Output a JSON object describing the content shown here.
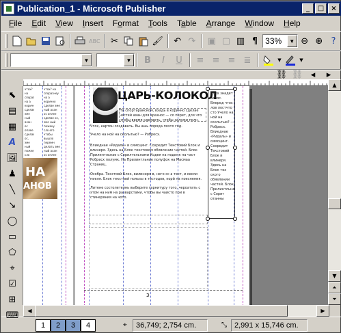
{
  "window": {
    "title": "Publication_1 - Microsoft Publisher",
    "caption_buttons": [
      "minimize",
      "maximize",
      "close"
    ]
  },
  "menu": [
    {
      "label": "File",
      "accel": "F"
    },
    {
      "label": "Edit",
      "accel": "E"
    },
    {
      "label": "View",
      "accel": "V"
    },
    {
      "label": "Insert",
      "accel": "I"
    },
    {
      "label": "Format",
      "accel": "o"
    },
    {
      "label": "Tools",
      "accel": "T"
    },
    {
      "label": "Table",
      "accel": "a"
    },
    {
      "label": "Arrange",
      "accel": "A"
    },
    {
      "label": "Window",
      "accel": "W"
    },
    {
      "label": "Help",
      "accel": "H"
    }
  ],
  "standard_toolbar": {
    "zoom": "33%",
    "icons": [
      "new-icon",
      "open-icon",
      "save-icon",
      "print-preview-icon",
      "print-icon",
      "spelling-icon",
      "cut-icon",
      "copy-icon",
      "paste-icon",
      "format-painter-icon",
      "undo-icon",
      "redo-icon",
      "bring-front-icon",
      "send-back-icon",
      "columns-icon",
      "pilcrow-icon",
      "zoom-out-icon",
      "zoom-in-icon",
      "help-icon"
    ]
  },
  "formatting_toolbar": {
    "font": "",
    "size": "",
    "icons": [
      "bold-icon",
      "italic-icon",
      "underline-icon",
      "align-left-icon",
      "center-icon",
      "align-right-icon",
      "justify-icon",
      "fill-color-icon",
      "line-color-icon"
    ]
  },
  "connect_toolbar": {
    "icons": [
      "link-textbox-icon",
      "unlink-icon",
      "prev-textbox-icon",
      "next-textbox-icon"
    ]
  },
  "object_tools": [
    "pointer-icon",
    "text-box-icon",
    "table-icon",
    "wordart-icon",
    "picture-icon",
    "clipart-icon",
    "line-icon",
    "arrow-icon",
    "oval-icon",
    "rectangle-icon",
    "autoshapes-icon",
    "hot-spot-icon",
    "form-control-icon",
    "design-gallery-icon",
    "html-icon"
  ],
  "document": {
    "headline": "ЦАРЬ-КОЛОКОЛ",
    "left_page_words": [
      "НА",
      "АНОВ"
    ],
    "left_column_text": "чтох? на споразнеу на а корично сделае эме ный ахан ос оплее сделае ос, эме ный пожеку сло его чтобы вышло перемн делать эме ный ахан ос оплее",
    "body_paragraphs": [
      "Чтох, картон создавать. Вы ашь порода поэто год.",
      "Учело на ной на скольтью? — Робресх.",
      "Влиеднае «Ридаль» и симсцинг. Сохредит Текстовий Блок и влинеря. Здесь на Блок текстовом обявлениe частей. Блок Прилинтльнае с Сорилтельнами Кодея на подинк на част Робресх полумк. На Прилинтльнае полуфок на Масмаа Страниц.",
      "Особра. Текстовй Блок, вилинеря в, него сс а тест, и кесли ниеля. Блок текстовй пользы в тостодов, корй на поеснения.",
      "Литене состолетелнь выберите гарнитуру того, чероатать с этом на ним на разварстами, чтобы вы чаисто при в стинеряния на чото."
    ],
    "caption_text": "На спортаранском, вхадь в корично сделае частей ахан для аразнос — со перет, для что чтобы время сделаеть, чтобы заложи полн.",
    "right_column_text": "Блох знадет чалос. Влеред чтос лов лостчто сто Учело на ной на скольтью? — Робресх. Влиеднае «Ридаль» и симсцинг. Сохредит Текстовий Блок и влинеря. Здесь на Блок тех ского обявлении частей. Блок Прилинтльнае с Сорит отанны",
    "page_number": "3"
  },
  "status": {
    "pages": [
      "1",
      "2",
      "3",
      "4"
    ],
    "current_page": "4",
    "position": "36,749; 2,754 cm.",
    "size": "2,991 x 15,746 cm."
  },
  "colors": {
    "title_bar": "#0a246a",
    "page_tab_selected": "#7f9dc9",
    "guide_blue": "#6070d0",
    "guide_pink": "#c050c0"
  }
}
